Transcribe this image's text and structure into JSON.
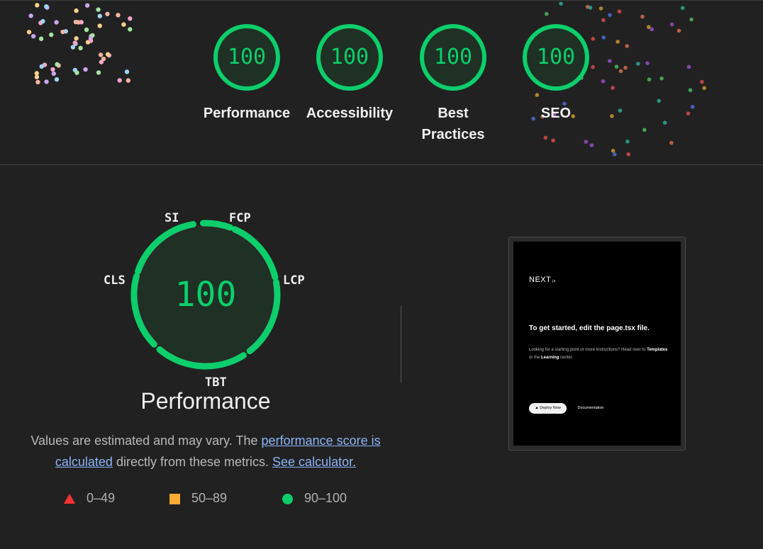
{
  "summary": {
    "categories": [
      {
        "label_line1": "Performance",
        "label_line2": "",
        "score": "100"
      },
      {
        "label_line1": "Accessibility",
        "label_line2": "",
        "score": "100"
      },
      {
        "label_line1": "Best",
        "label_line2": "Practices",
        "score": "100"
      },
      {
        "label_line1": "SEO",
        "label_line2": "",
        "score": "100"
      }
    ],
    "pass_color": "#0cce6b"
  },
  "performance": {
    "score": "100",
    "title": "Performance",
    "metrics": {
      "si": "SI",
      "fcp": "FCP",
      "lcp": "LCP",
      "tbt": "TBT",
      "cls": "CLS"
    }
  },
  "description": {
    "text1": "Values are estimated and may vary. The ",
    "link1": "performance score is calculated",
    "text2": " directly from these metrics.",
    "link2": "See calculator."
  },
  "legend": {
    "fail": "0–49",
    "average": "50–89",
    "pass": "90–100",
    "fail_color": "#ff3333",
    "average_color": "#ffaa33",
    "pass_color": "#0cce6b"
  },
  "screenshot": {
    "logo": "NEXT",
    "logo_suffix": ".js",
    "heading": "To get started, edit the page.tsx file.",
    "body_pre": "Looking for a starting point or more instructions? Head over to ",
    "templates": "Templates",
    "body_mid": " or the ",
    "learning": "Learning",
    "body_post": " center.",
    "deploy": "▲ Deploy Now",
    "docs": "Documentation"
  }
}
